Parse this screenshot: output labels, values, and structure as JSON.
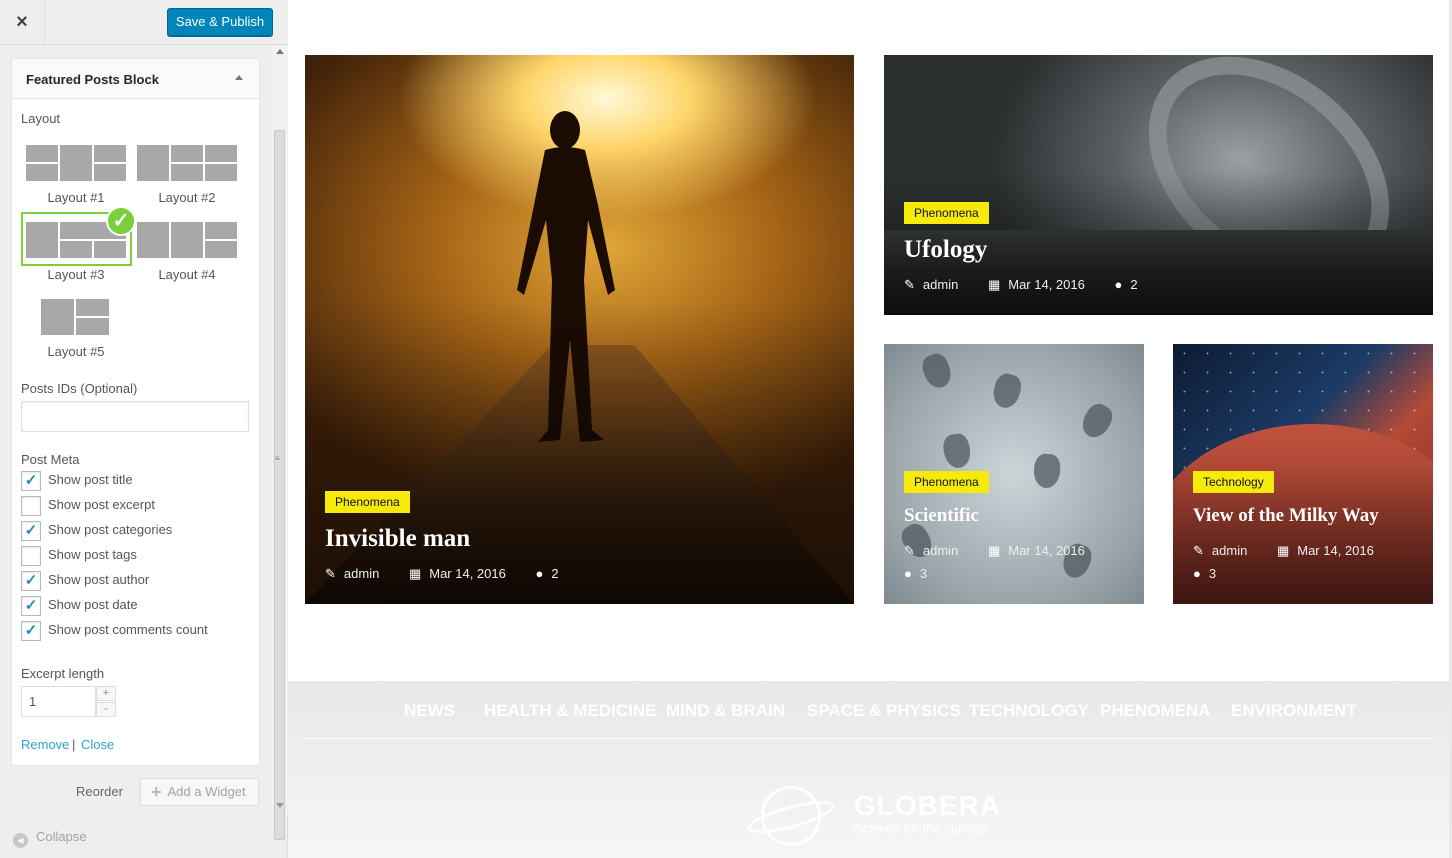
{
  "header": {
    "close_icon": "×",
    "publish_label": "Save & Publish"
  },
  "widget": {
    "title": "Featured Posts Block",
    "layout_label": "Layout",
    "layouts": [
      {
        "label": "Layout #1",
        "selected": false
      },
      {
        "label": "Layout #2",
        "selected": false
      },
      {
        "label": "Layout #3",
        "selected": true
      },
      {
        "label": "Layout #4",
        "selected": false
      },
      {
        "label": "Layout #5",
        "selected": false
      }
    ],
    "posts_ids_label": "Posts IDs (Optional)",
    "posts_ids_value": "",
    "post_meta_label": "Post Meta",
    "meta_options": [
      {
        "label": "Show post title",
        "checked": true
      },
      {
        "label": "Show post excerpt",
        "checked": false
      },
      {
        "label": "Show post categories",
        "checked": true
      },
      {
        "label": "Show post tags",
        "checked": false
      },
      {
        "label": "Show post author",
        "checked": true
      },
      {
        "label": "Show post date",
        "checked": true
      },
      {
        "label": "Show post comments count",
        "checked": true
      }
    ],
    "excerpt_label": "Excerpt length",
    "excerpt_value": "1",
    "spin_up": "+",
    "spin_down": "-",
    "remove_label": "Remove",
    "separator": "|",
    "close_label": "Close"
  },
  "footer_controls": {
    "reorder_label": "Reorder",
    "add_widget_label": "Add a Widget",
    "collapse_label": "Collapse"
  },
  "posts": [
    {
      "category": "Phenomena",
      "title": "Invisible man",
      "author": "admin",
      "date": "Mar 14, 2016",
      "comments": "2"
    },
    {
      "category": "Phenomena",
      "title": "Ufology",
      "author": "admin",
      "date": "Mar 14, 2016",
      "comments": "2"
    },
    {
      "category": "Phenomena",
      "title": "Scientific",
      "author": "admin",
      "date": "Mar 14, 2016",
      "comments": "3"
    },
    {
      "category": "Technology",
      "title": "View of the Milky Way",
      "author": "admin",
      "date": "Mar 14, 2016",
      "comments": "3"
    }
  ],
  "site_footer": {
    "nav": [
      "NEWS",
      "HEALTH & MEDICINE",
      "MIND & BRAIN",
      "SPACE & PHYSICS",
      "TECHNOLOGY",
      "PHENOMENA",
      "ENVIRONMENT"
    ],
    "logo_name": "GLOBERA",
    "logo_tagline": "Science for the curious!"
  },
  "colors": {
    "accent": "#0085ba",
    "selected_layout": "#7ad03a",
    "badge": "#f5ea0a",
    "link": "#2ea2cc"
  }
}
